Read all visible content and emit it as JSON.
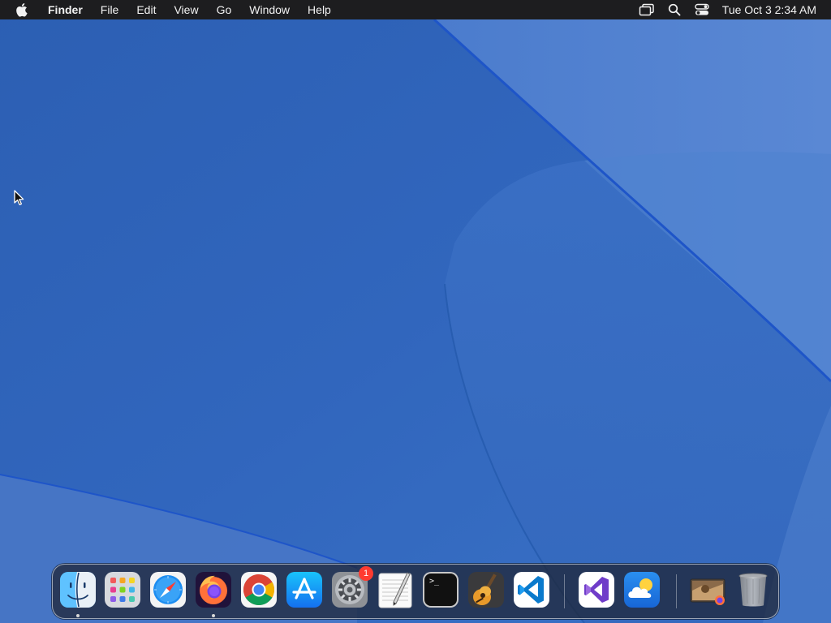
{
  "menubar": {
    "app_name": "Finder",
    "menus": [
      "File",
      "Edit",
      "View",
      "Go",
      "Window",
      "Help"
    ],
    "clock": "Tue Oct 3  2:34 AM",
    "status_icons": [
      "display-mirroring-icon",
      "spotlight-search-icon",
      "control-center-icon"
    ]
  },
  "dock": {
    "apps": [
      {
        "id": "finder",
        "icon": "finder-icon",
        "running": true
      },
      {
        "id": "launchpad",
        "icon": "launchpad-icon",
        "running": false
      },
      {
        "id": "safari",
        "icon": "safari-icon",
        "running": false
      },
      {
        "id": "firefox",
        "icon": "firefox-icon",
        "running": true
      },
      {
        "id": "chrome",
        "icon": "chrome-icon",
        "running": false
      },
      {
        "id": "app-store",
        "icon": "app-store-icon",
        "running": false
      },
      {
        "id": "system-settings",
        "icon": "system-settings-icon",
        "running": false,
        "badge": "1"
      },
      {
        "id": "textedit",
        "icon": "textedit-icon",
        "running": false
      },
      {
        "id": "terminal",
        "icon": "terminal-icon",
        "running": false
      },
      {
        "id": "garageband",
        "icon": "garageband-icon",
        "running": false
      },
      {
        "id": "vscode",
        "icon": "vscode-icon",
        "running": false
      },
      {
        "id": "visual-studio",
        "icon": "visual-studio-icon",
        "running": false
      },
      {
        "id": "weather",
        "icon": "weather-icon",
        "running": false
      },
      {
        "id": "recent-preview",
        "icon": "preview-thumbnail-icon",
        "running": false
      },
      {
        "id": "trash",
        "icon": "trash-icon",
        "running": false
      }
    ],
    "terminal_prompt": ">_"
  },
  "colors": {
    "wallpaper_base": "#2f63b8",
    "wallpaper_light": "#4f7fd0",
    "menubar_bg": "#1d1d1f",
    "badge": "#ff3b30"
  }
}
